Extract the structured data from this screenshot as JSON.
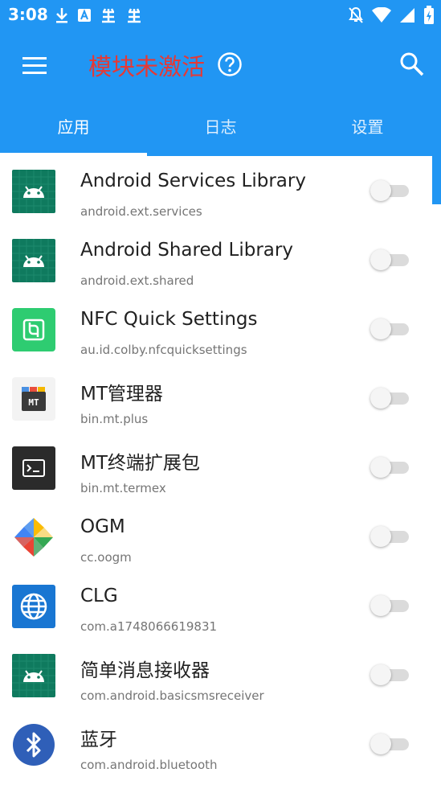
{
  "status_bar": {
    "time": "3:08",
    "left_icons": [
      "download-icon",
      "font-a-icon",
      "bug-icon",
      "bug-icon"
    ],
    "right_icons": [
      "notifications-off-icon",
      "wifi-icon",
      "signal-icon",
      "battery-charging-icon"
    ]
  },
  "toolbar": {
    "title": "模块未激活",
    "title_color": "#e53935",
    "accent": "#2196f3"
  },
  "tabs": [
    {
      "label": "应用",
      "active": true
    },
    {
      "label": "日志",
      "active": false
    },
    {
      "label": "设置",
      "active": false
    }
  ],
  "apps": [
    {
      "name": "Android Services Library",
      "package": "android.ext.services",
      "icon": "android-icon",
      "enabled": false
    },
    {
      "name": "Android Shared Library",
      "package": "android.ext.shared",
      "icon": "android-icon",
      "enabled": false
    },
    {
      "name": "NFC Quick Settings",
      "package": "au.id.colby.nfcquicksettings",
      "icon": "nfc-icon",
      "enabled": false
    },
    {
      "name": "MT管理器",
      "package": "bin.mt.plus",
      "icon": "mt-manager-icon",
      "enabled": false
    },
    {
      "name": "MT终端扩展包",
      "package": "bin.mt.termex",
      "icon": "terminal-icon",
      "enabled": false
    },
    {
      "name": "OGM",
      "package": "cc.oogm",
      "icon": "pinwheel-icon",
      "enabled": false
    },
    {
      "name": "CLG",
      "package": "com.a1748066619831",
      "icon": "globe-icon",
      "enabled": false
    },
    {
      "name": "简单消息接收器",
      "package": "com.android.basicsmsreceiver",
      "icon": "android-icon",
      "enabled": false
    },
    {
      "name": "蓝牙",
      "package": "com.android.bluetooth",
      "icon": "bluetooth-icon",
      "enabled": false
    }
  ]
}
